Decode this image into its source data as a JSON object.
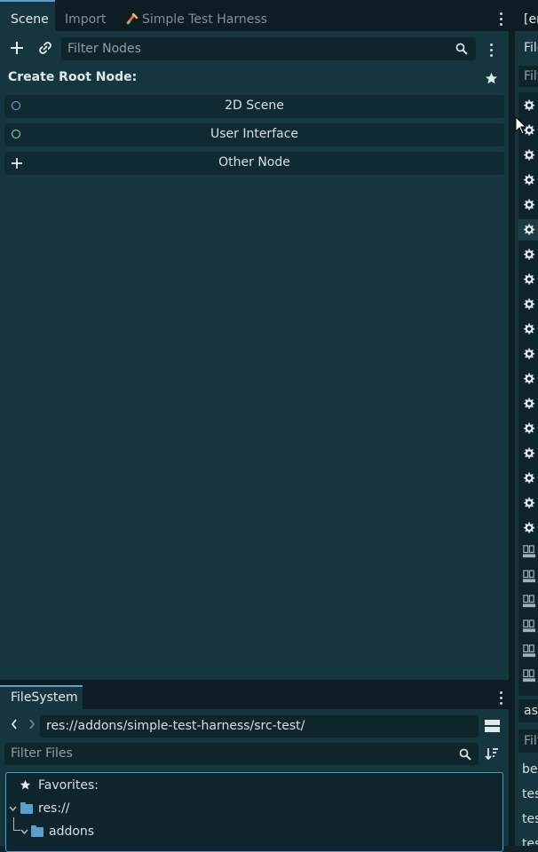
{
  "scene_dock": {
    "tabs": [
      {
        "label": "Scene"
      },
      {
        "label": "Import"
      },
      {
        "label": "Simple Test Harness"
      }
    ],
    "filter_placeholder": "Filter Nodes",
    "create_root_title": "Create Root Node:",
    "root_options": [
      {
        "label": "2D Scene",
        "color": "#8da5f3"
      },
      {
        "label": "User Interface",
        "color": "#8eef97"
      },
      {
        "label": "Other Node"
      }
    ]
  },
  "right_strip": {
    "top_tab": "[er",
    "fil_label": "File",
    "filter_text": "Filt",
    "as_label": "as",
    "filter2_text": "Filt",
    "list": [
      "be",
      "tes",
      "tes",
      "tes"
    ]
  },
  "filesystem": {
    "tab_label": "FileSystem",
    "path": "res://addons/simple-test-harness/src-test/",
    "filter_placeholder": "Filter Files",
    "tree": [
      {
        "label": "Favorites:"
      },
      {
        "label": "res://"
      },
      {
        "label": "addons"
      }
    ]
  },
  "colors": {
    "accent": "#5b9fd0",
    "panel": "#16363f",
    "background": "#10232b"
  }
}
